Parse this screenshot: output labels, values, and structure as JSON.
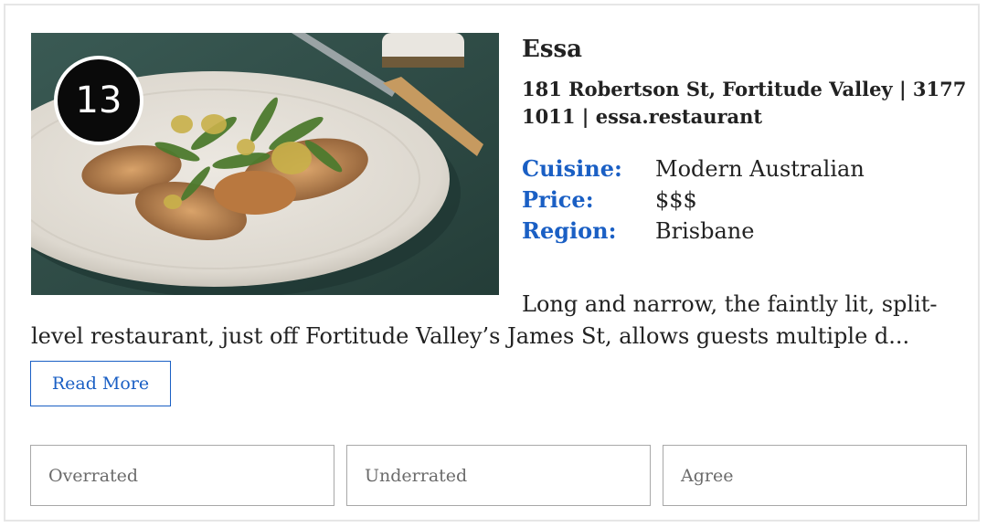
{
  "listing": {
    "rank": "13",
    "name": "Essa",
    "address": "181 Robertson St, Fortitude Valley | 3177 1011 | essa.restaurant",
    "facts": [
      {
        "label": "Cuisine:",
        "value": "Modern Australian"
      },
      {
        "label": "Price:",
        "value": "$$$"
      },
      {
        "label": "Region:",
        "value": "Brisbane"
      }
    ],
    "description": "Long and narrow, the faintly lit, split-level restaurant, just off Fortitude Valley’s James St, allows guests multiple d...",
    "read_more_label": "Read More"
  },
  "votes": [
    {
      "label": "Overrated"
    },
    {
      "label": "Underrated"
    },
    {
      "label": "Agree"
    }
  ],
  "colors": {
    "accent": "#1a5fc4",
    "badge": "#0a0a0a",
    "border": "#e6e6e6"
  }
}
